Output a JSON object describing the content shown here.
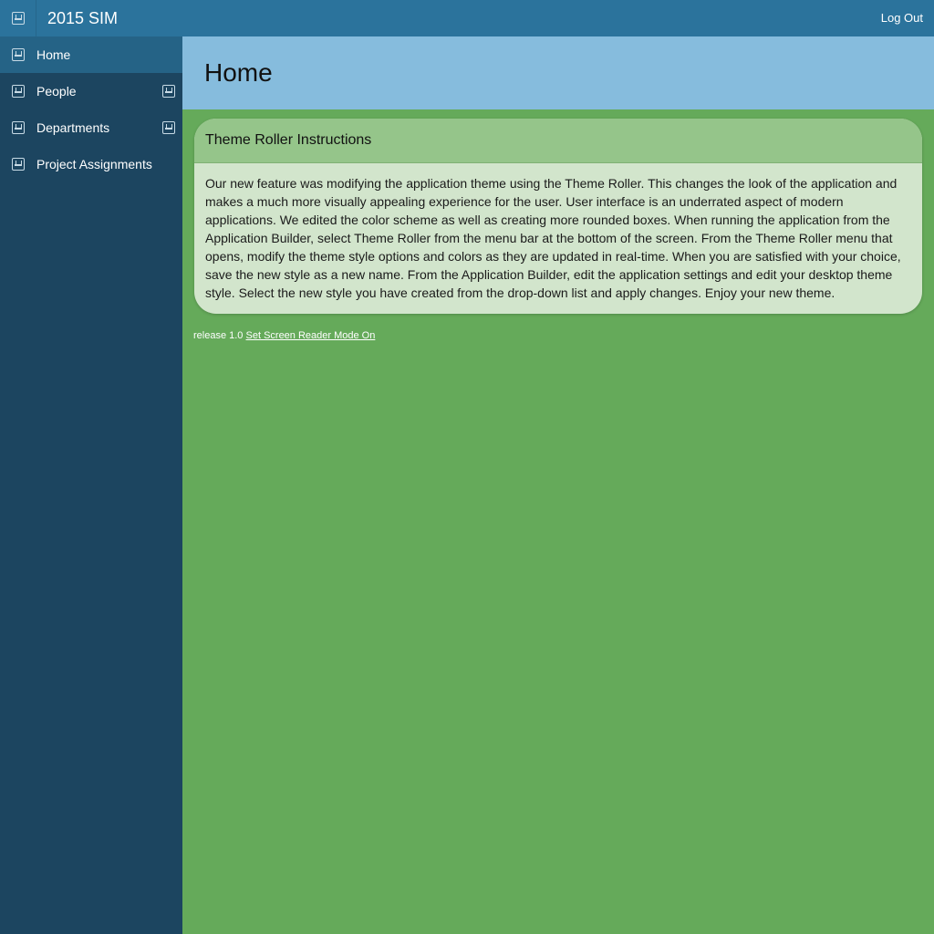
{
  "header": {
    "app_title": "2015 SIM",
    "logout_label": "Log Out",
    "menu_icon": "menu-toggle-icon"
  },
  "sidebar": {
    "items": [
      {
        "label": "Home",
        "icon": "home-icon",
        "active": true,
        "expandable": false
      },
      {
        "label": "People",
        "icon": "people-icon",
        "active": false,
        "expandable": true
      },
      {
        "label": "Departments",
        "icon": "departments-icon",
        "active": false,
        "expandable": true
      },
      {
        "label": "Project Assignments",
        "icon": "project-assignments-icon",
        "active": false,
        "expandable": false
      }
    ]
  },
  "main": {
    "page_title": "Home",
    "region": {
      "title": "Theme Roller Instructions",
      "body": "Our new feature was modifying the application theme using the Theme Roller. This changes the look of the application and makes a much more visually appealing experience for the user. User interface is an underrated aspect of modern applications. We edited the color scheme as well as creating more rounded boxes. When running the application from the Application Builder, select Theme Roller from the menu bar at the bottom of the screen. From the Theme Roller menu that opens, modify the theme style options and colors as they are updated in real-time. When you are satisfied with your choice, save the new style as a new name. From the Application Builder, edit the application settings and edit your desktop theme style. Select the new style you have created from the drop-down list and apply changes. Enjoy your new theme."
    }
  },
  "footer": {
    "release": "release 1.0",
    "screen_reader_link": "Set Screen Reader Mode On"
  },
  "colors": {
    "topbar": "#2b739c",
    "sidebar": "#1c4560",
    "sidebar_active": "#256386",
    "title_bar": "#86bcdd",
    "page_background": "#65aa5a",
    "region_header": "#95c58a",
    "region_body": "#d2e5cc"
  }
}
